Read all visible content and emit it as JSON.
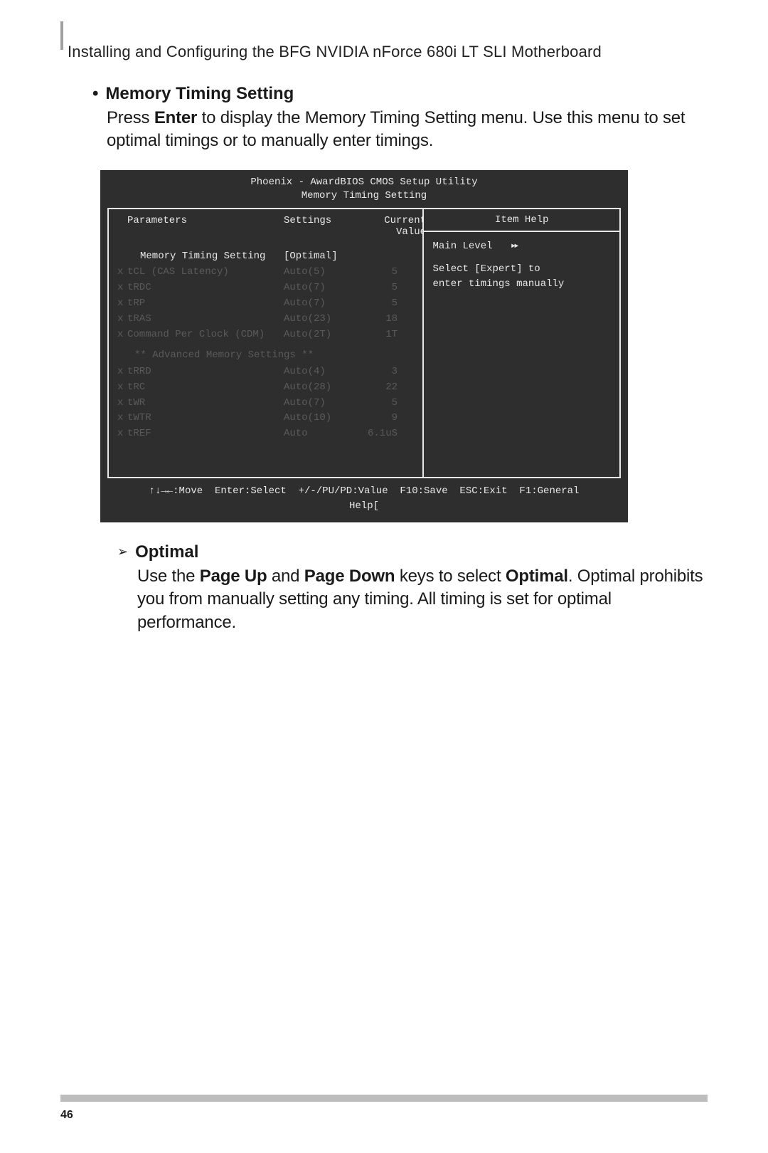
{
  "header": {
    "text": "Installing and Configuring the BFG NVIDIA nForce 680i LT SLI Motherboard"
  },
  "section1": {
    "title": "Memory Timing Setting",
    "body_pre": "Press ",
    "body_enter": "Enter",
    "body_post": " to display the Memory Timing Setting menu. Use this menu to set optimal timings or to manually enter timings."
  },
  "bios": {
    "title_line1": "Phoenix - AwardBIOS CMOS Setup Utility",
    "title_line2": "Memory Timing Setting",
    "col_parameters": "Parameters",
    "col_settings": "Settings",
    "col_current": "Current Value",
    "help_header": "Item Help",
    "main_level": "Main Level",
    "help_line1": "Select [Expert] to",
    "help_line2": "enter timings manually",
    "advanced_header": "** Advanced Memory Settings **",
    "rows_top": [
      {
        "prefix": "",
        "name": "Memory Timing Setting",
        "setting": "[Optimal]",
        "current": "",
        "indent": true,
        "dim": false
      },
      {
        "prefix": "x",
        "name": "tCL (CAS Latency)",
        "setting": "Auto(5)",
        "current": "5",
        "indent": false,
        "dim": true
      },
      {
        "prefix": "x",
        "name": "tRDC",
        "setting": "Auto(7)",
        "current": "5",
        "indent": false,
        "dim": true
      },
      {
        "prefix": "x",
        "name": "tRP",
        "setting": "Auto(7)",
        "current": "5",
        "indent": false,
        "dim": true
      },
      {
        "prefix": "x",
        "name": "tRAS",
        "setting": "Auto(23)",
        "current": "18",
        "indent": false,
        "dim": true
      },
      {
        "prefix": "x",
        "name": "Command Per Clock (CDM)",
        "setting": "Auto(2T)",
        "current": "1T",
        "indent": false,
        "dim": true
      }
    ],
    "rows_bottom": [
      {
        "prefix": "x",
        "name": "tRRD",
        "setting": "Auto(4)",
        "current": "3",
        "dim": true
      },
      {
        "prefix": "x",
        "name": "tRC",
        "setting": "Auto(28)",
        "current": "22",
        "dim": true
      },
      {
        "prefix": "x",
        "name": "tWR",
        "setting": "Auto(7)",
        "current": "5",
        "dim": true
      },
      {
        "prefix": "x",
        "name": "tWTR",
        "setting": "Auto(10)",
        "current": "9",
        "dim": true
      },
      {
        "prefix": "x",
        "name": "tREF",
        "setting": "Auto",
        "current": "6.1uS",
        "dim": true
      }
    ],
    "footer_line1": "↑↓→←:Move  Enter:Select  +/-/PU/PD:Value  F10:Save  ESC:Exit  F1:General",
    "footer_line2": "Help["
  },
  "section2": {
    "title": "Optimal",
    "body_pre": "Use the ",
    "b1": "Page Up",
    "mid1": " and ",
    "b2": "Page Down",
    "mid2": " keys to select ",
    "b3": "Optimal",
    "body_post": ". Optimal prohibits you from manually setting any timing. All timing is set for optimal performance."
  },
  "page_number": "46"
}
